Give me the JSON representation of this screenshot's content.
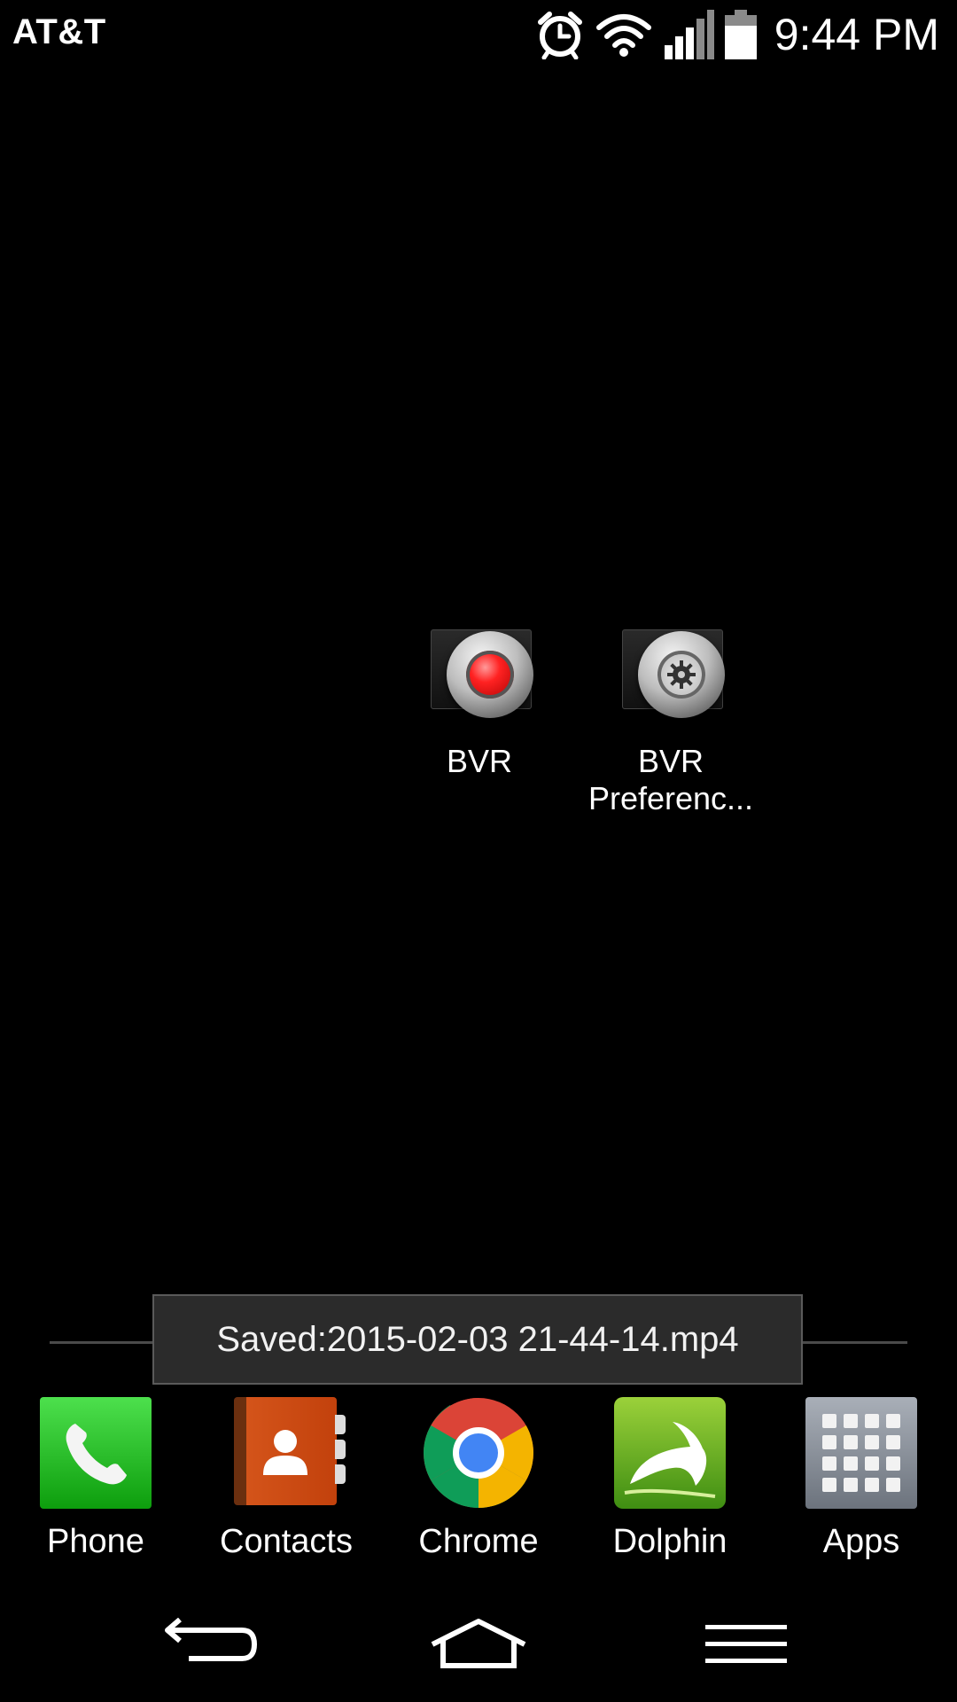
{
  "status_bar": {
    "carrier": "AT&T",
    "time": "9:44 PM",
    "icons": [
      "alarm-icon",
      "wifi-icon",
      "signal-icon",
      "battery-icon"
    ]
  },
  "desktop": {
    "shortcuts": [
      {
        "label": "BVR",
        "icon": "record-button-icon"
      },
      {
        "label": "BVR Preferenc...",
        "label_line1": "BVR",
        "label_line2": "Preferenc...",
        "icon": "settings-gear-icon"
      }
    ]
  },
  "toast": {
    "message": "Saved:2015-02-03 21-44-14.mp4"
  },
  "dock": {
    "items": [
      {
        "label": "Phone",
        "icon": "phone-icon"
      },
      {
        "label": "Contacts",
        "icon": "contacts-icon"
      },
      {
        "label": "Chrome",
        "icon": "chrome-icon"
      },
      {
        "label": "Dolphin",
        "icon": "dolphin-icon"
      },
      {
        "label": "Apps",
        "icon": "apps-grid-icon"
      }
    ]
  },
  "nav_bar": {
    "buttons": [
      "back",
      "home",
      "menu"
    ]
  },
  "colors": {
    "background": "#000000",
    "toast_bg": "#2b2b2b",
    "record_red": "#ff2222",
    "phone_green": "#1bb51b",
    "contacts_orange": "#d4541a",
    "dolphin_green": "#6cb624"
  }
}
